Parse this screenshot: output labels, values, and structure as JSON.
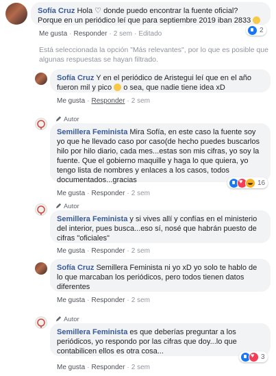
{
  "comments": [
    {
      "name": "Sofía Cruz",
      "text": "Hola ♡ donde puedo encontrar la fuente oficial? Porque en un periódico leí que para septiembre 2019 iban 2833",
      "like": "Me gusta",
      "reply": "Responder",
      "time": "2 sem",
      "edited": "Editado",
      "reaction_count": "2"
    },
    {
      "name": "Sofía Cruz",
      "text": "Y en el periódico de Aristegui leí que en el año fueron mil y pico",
      "text_after": "o sea, que nadie tiene idea xD",
      "like": "Me gusta",
      "reply": "Responder",
      "time": "2 sem"
    },
    {
      "author_tag": "Autor",
      "name": "Semillera Feminista",
      "text": "Mira Sofía, en este caso la fuente soy yo que he llevado caso por caso(de hecho puedes buscarlos hilo por hilo diario, cada mes...estas son mis cifras, yo soy la fuente. Que el gobierno maquille y haga lo que quiera, yo tengo lista de nombres y enlaces a los casos, todos documentados...gracias",
      "like": "Me gusta",
      "reply": "Responder",
      "time": "2 sem",
      "reaction_count": "16"
    },
    {
      "author_tag": "Autor",
      "name": "Semillera Feminista",
      "text": "y si vives allí y confías en el ministerio del interior, pues busca...eso sí, nosé que habrán puesto de cifras \"oficiales\"",
      "like": "Me gusta",
      "reply": "Responder",
      "time": "2 sem"
    },
    {
      "name": "Sofía Cruz",
      "text": "Semillera Feminista ni yo xD yo solo te hablo de lo que marcaban los periódicos, pero todos tienen datos diferentes",
      "like": "Me gusta",
      "reply": "Responder",
      "time": "2 sem"
    },
    {
      "author_tag": "Autor",
      "name": "Semillera Feminista",
      "text": "es que deberías preguntar a los periódicos, yo respondo por las cifras que doy...lo que contabilicen ellos es otra cosa...",
      "like": "Me gusta",
      "reply": "Responder",
      "time": "2 sem",
      "reaction_count": "3"
    }
  ],
  "notice": "Está seleccionada la opción \"Más relevantes\", por lo que es posible que algunas respuestas se hayan filtrado.",
  "colors": {
    "name": "#385898",
    "bubble": "#f2f3f5",
    "meta": "#90949c",
    "like_blue": "#1877f2",
    "love_red": "#f33e58",
    "haha_yellow": "#f7b125"
  },
  "icons": {
    "author_badge": "pencil-icon",
    "reaction_like": "like-reaction-icon",
    "reaction_love": "love-reaction-icon",
    "reaction_haha": "haha-reaction-icon",
    "emoji": "emoji-icon"
  }
}
